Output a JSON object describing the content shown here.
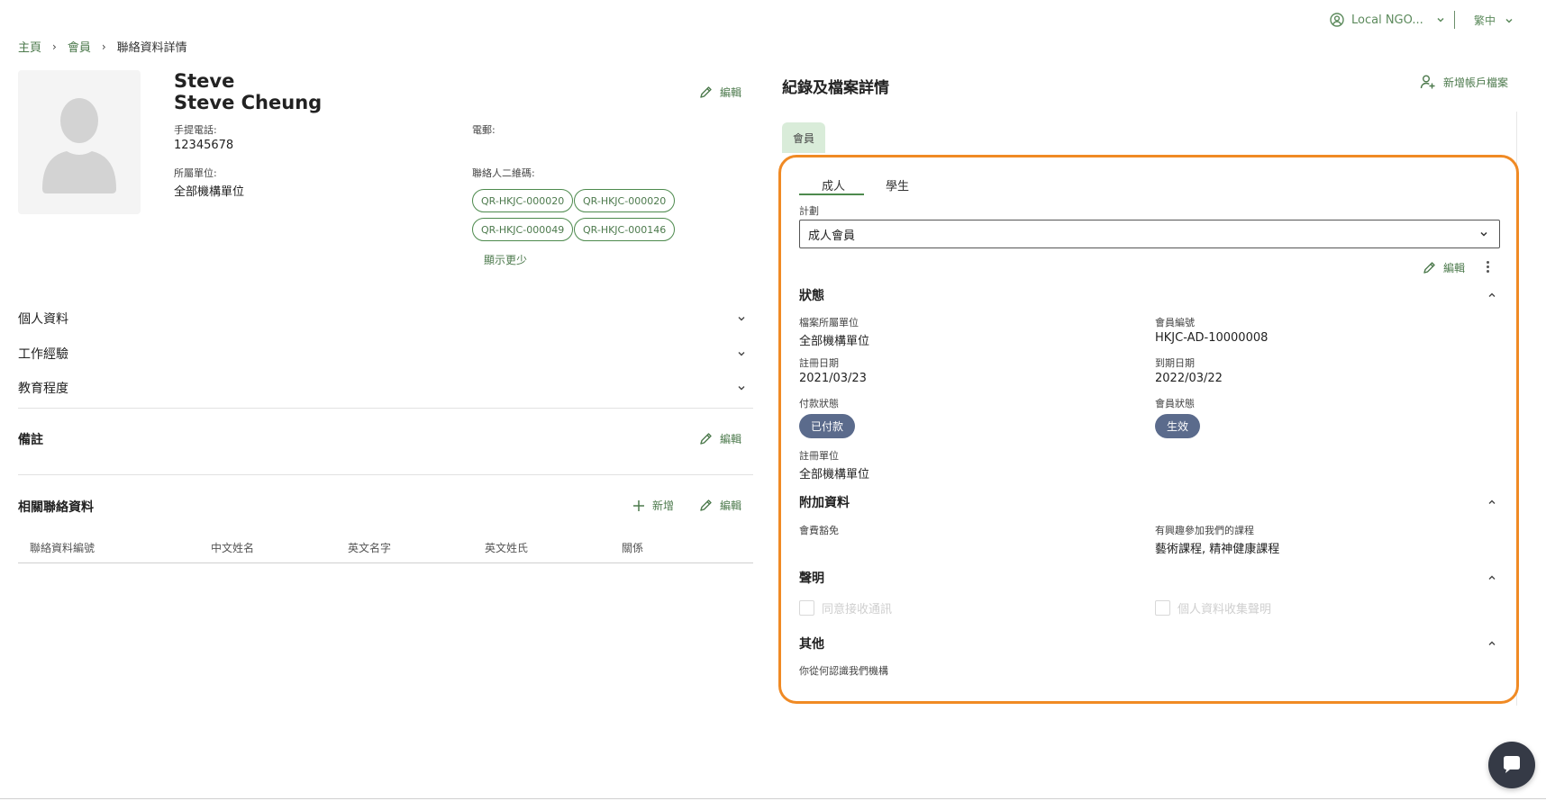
{
  "header": {
    "org_label": "Local NGO...",
    "lang_label": "繁中"
  },
  "breadcrumb": [
    "主頁",
    "會員",
    "聯絡資料詳情"
  ],
  "profile": {
    "first_name": "Steve",
    "full_name": "Steve Cheung",
    "edit_label": "編輯",
    "phone_label": "手提電話:",
    "phone_value": "12345678",
    "email_label": "電郵:",
    "unit_label": "所屬單位:",
    "unit_value": "全部機構單位",
    "qr_label": "聯絡人二維碼:",
    "qr_codes": [
      "QR-HKJC-000020",
      "QR-HKJC-000020",
      "QR-HKJC-000049",
      "QR-HKJC-000146"
    ],
    "show_less": "顯示更少"
  },
  "accordions": [
    "個人資料",
    "工作經驗",
    "教育程度"
  ],
  "notes": {
    "title": "備註",
    "edit_label": "編輯"
  },
  "related": {
    "title": "相關聯絡資料",
    "add_label": "新增",
    "edit_label": "編輯",
    "columns": [
      "聯絡資料編號",
      "中文姓名",
      "英文名字",
      "英文姓氏",
      "關係"
    ]
  },
  "records": {
    "title": "紀錄及檔案詳情",
    "add_profile_label": "新增帳戶檔案",
    "tab_label": "會員",
    "subtabs": [
      "成人",
      "學生"
    ],
    "plan_label": "計劃",
    "plan_value": "成人會員",
    "edit_label": "編輯",
    "status": {
      "title": "狀態",
      "profile_unit_label": "檔案所屬單位",
      "profile_unit_value": "全部機構單位",
      "member_no_label": "會員編號",
      "member_no_value": "HKJC-AD-10000008",
      "reg_date_label": "註冊日期",
      "reg_date_value": "2021/03/23",
      "expiry_label": "到期日期",
      "expiry_value": "2022/03/22",
      "payment_label": "付款狀態",
      "payment_value": "已付款",
      "member_status_label": "會員狀態",
      "member_status_value": "生效",
      "reg_unit_label": "註冊單位",
      "reg_unit_value": "全部機構單位"
    },
    "extra": {
      "title": "附加資料",
      "fee_waiver_label": "會費豁免",
      "courses_label": "有興趣參加我們的課程",
      "courses_value": "藝術課程, 精神健康課程"
    },
    "declaration": {
      "title": "聲明",
      "consent_label": "同意接收通訊",
      "privacy_label": "個人資料收集聲明"
    },
    "other": {
      "title": "其他",
      "how_know_label": "你從何認識我們機構"
    }
  },
  "colors": {
    "accent_green": "#4d7a4d",
    "highlight_orange": "#f08a24",
    "pill_slate": "#5b6b8c",
    "tab_bg": "#d9ecd9"
  },
  "icons": [
    "user-circle-icon",
    "chevron-down-icon",
    "pencil-icon",
    "plus-icon",
    "add-user-icon",
    "chevron-up-icon",
    "kebab-icon",
    "chat-icon"
  ]
}
